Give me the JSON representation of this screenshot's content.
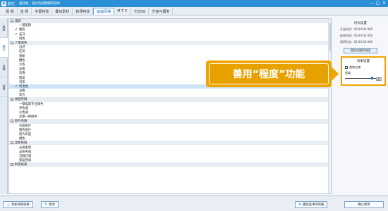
{
  "window": {
    "app_name": "影忆",
    "slogan": "超轻松、强大的视频制作软件",
    "buttons": [
      "—",
      "□",
      "✕"
    ]
  },
  "tabs": [
    "视 频",
    "音 频",
    "字幕特效",
    "叠加素材",
    "转场特效",
    "画面风格",
    "M T V",
    "卡拉OK",
    "升级与服务"
  ],
  "active_tab_index": 5,
  "sidebar": [
    "画面",
    "美化",
    "滤镜",
    "动景"
  ],
  "active_sidebar_index": 1,
  "list": [
    {
      "type": "cat",
      "text": "美颜"
    },
    {
      "type": "item",
      "text": "一键美颜"
    },
    {
      "type": "checked",
      "text": "磨皮"
    },
    {
      "type": "checked",
      "text": "美白"
    },
    {
      "type": "item",
      "text": "锐色"
    },
    {
      "type": "cat",
      "text": "人像调色"
    },
    {
      "type": "item",
      "text": "自然"
    },
    {
      "type": "item",
      "text": "红润"
    },
    {
      "type": "item",
      "text": "清新"
    },
    {
      "type": "item",
      "text": "糖色"
    },
    {
      "type": "item",
      "text": "冷色"
    },
    {
      "type": "item",
      "text": "淡雅"
    },
    {
      "type": "item",
      "text": "浓香"
    },
    {
      "type": "item",
      "text": "甜美"
    },
    {
      "type": "item",
      "text": "日系"
    },
    {
      "type": "checked_selected",
      "text": "阿宝色"
    },
    {
      "type": "item",
      "text": "淡雅"
    },
    {
      "type": "item",
      "text": "复古"
    },
    {
      "type": "cat",
      "text": "画面色调"
    },
    {
      "type": "item",
      "text": "一键电影专业调色"
    },
    {
      "type": "item",
      "text": "单色调"
    },
    {
      "type": "item",
      "text": "沙色调"
    },
    {
      "type": "item",
      "text": "深夏一种颜色"
    },
    {
      "type": "cat",
      "text": "胶片色调"
    },
    {
      "type": "item",
      "text": "负面胶片"
    },
    {
      "type": "item",
      "text": "银色胶片"
    },
    {
      "type": "item",
      "text": "胶片彩度"
    },
    {
      "type": "item",
      "text": "褪色"
    },
    {
      "type": "cat",
      "text": "柔和色调"
    },
    {
      "type": "item",
      "text": "淡褐柔和"
    },
    {
      "type": "item",
      "text": "淡粉色调"
    },
    {
      "type": "item",
      "text": "沉静红调"
    },
    {
      "type": "item",
      "text": "紫蓝色调"
    },
    {
      "type": "cat",
      "text": "鲜艳色调"
    }
  ],
  "right_panel": {
    "title": "时间设置",
    "lines": [
      {
        "label": "开始时间:",
        "value": "00:00:00.000"
      },
      {
        "label": "结束时间:",
        "value": "00:00:00.000"
      },
      {
        "label": "透明时长:",
        "value": "00:00:00.000"
      }
    ],
    "button": "提交风格时间段"
  },
  "effect": {
    "title": "效果设置",
    "checkbox": "柔和过渡",
    "label": "程度:",
    "value": "90",
    "level": 0.9
  },
  "callout": "善用“程度”功能",
  "bottom": {
    "add": "添加风格效果",
    "modify": "修改",
    "delete": "删除选中的风格",
    "confirm": "确认修改"
  }
}
